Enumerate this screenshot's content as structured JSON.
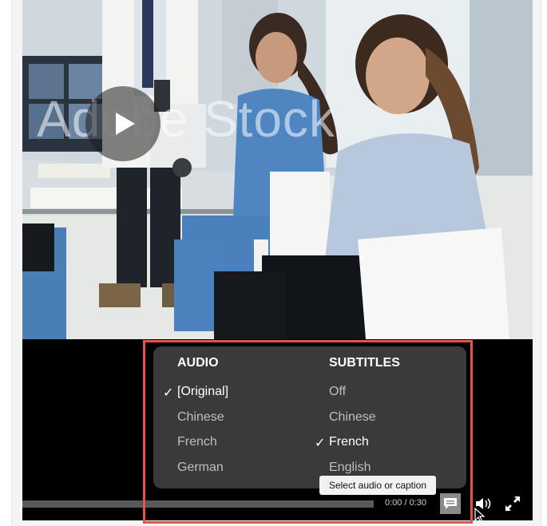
{
  "video": {
    "watermark": "Adobe Stock"
  },
  "menu": {
    "audio": {
      "heading": "AUDIO",
      "options": [
        {
          "label": "[Original]",
          "selected": true
        },
        {
          "label": "Chinese",
          "selected": false
        },
        {
          "label": "French",
          "selected": false
        },
        {
          "label": "German",
          "selected": false
        }
      ]
    },
    "subtitles": {
      "heading": "SUBTITLES",
      "options": [
        {
          "label": "Off",
          "selected": false
        },
        {
          "label": "Chinese",
          "selected": false
        },
        {
          "label": "French",
          "selected": true
        },
        {
          "label": "English",
          "selected": false
        }
      ]
    },
    "check_glyph": "✓"
  },
  "tooltip": {
    "text": "Select audio or caption"
  },
  "controls": {
    "time": "0:00 / 0:30",
    "progress": 0,
    "captions_icon": "captions-icon",
    "volume_icon": "volume-icon",
    "fullscreen_icon": "fullscreen-icon"
  },
  "colors": {
    "highlight": "#e4544d",
    "menu_background": "#3a3a3a",
    "player_background": "#000000"
  }
}
